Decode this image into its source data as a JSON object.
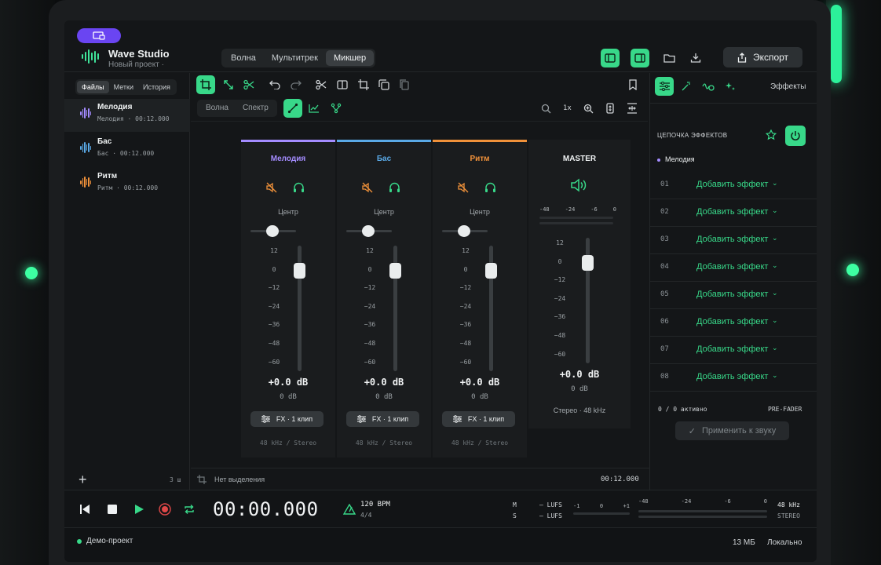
{
  "app": {
    "title": "Wave Studio",
    "subtitle": "Новый проект ·",
    "modes": [
      "Волна",
      "Мультитрек",
      "Микшер"
    ],
    "active_mode": "Микшер",
    "export_label": "Экспорт"
  },
  "sidebar": {
    "tabs": [
      "Файлы",
      "Метки",
      "История"
    ],
    "tracks": [
      {
        "name": "Мелодия",
        "meta": "Мелодия · 00:12.000",
        "color": "#a48cff"
      },
      {
        "name": "Бас",
        "meta": "Бас · 00:12.000",
        "color": "#5aa9e6"
      },
      {
        "name": "Ритм",
        "meta": "Ритм · 00:12.000",
        "color": "#f0913a"
      }
    ],
    "count": "3 ш"
  },
  "editor": {
    "views": [
      "Волна",
      "Спектр"
    ],
    "speed": "1x"
  },
  "mixer": {
    "scale": [
      "12",
      "0",
      "−12",
      "−24",
      "−36",
      "−48",
      "−60"
    ],
    "pan_label": "Центр",
    "channels": [
      {
        "name": "Мелодия",
        "color": "#a48cff",
        "gain": "+0.0 dB",
        "db": "0 dB",
        "fx": "FX · 1 клип",
        "format": "48 kHz / Stereo"
      },
      {
        "name": "Бас",
        "color": "#5aa9e6",
        "gain": "+0.0 dB",
        "db": "0 dB",
        "fx": "FX · 1 клип",
        "format": "48 kHz / Stereo"
      },
      {
        "name": "Ритм",
        "color": "#f0913a",
        "gain": "+0.0 dB",
        "db": "0 dB",
        "fx": "FX · 1 клип",
        "format": "48 kHz / Stereo"
      }
    ],
    "master": {
      "name": "MASTER",
      "meter_scale": [
        "-48",
        "-24",
        "-6",
        "0"
      ],
      "gain": "+0.0 dB",
      "db": "0 dB",
      "format": "Стерео · 48 kHz"
    }
  },
  "effects": {
    "tab_label": "Эффекты",
    "chain_title": "ЦЕПОЧКА ЭФФЕКТОВ",
    "track": "Мелодия",
    "slots": [
      {
        "num": "01",
        "label": "Добавить эффект"
      },
      {
        "num": "02",
        "label": "Добавить эффект"
      },
      {
        "num": "03",
        "label": "Добавить эффект"
      },
      {
        "num": "04",
        "label": "Добавить эффект"
      },
      {
        "num": "05",
        "label": "Добавить эффект"
      },
      {
        "num": "06",
        "label": "Добавить эффект"
      },
      {
        "num": "07",
        "label": "Добавить эффект"
      },
      {
        "num": "08",
        "label": "Добавить эффект"
      }
    ],
    "active_count": "0 / 0 активно",
    "pre_fader": "PRE-FADER",
    "apply_label": "Применить к звуку"
  },
  "status": {
    "selection": "Нет выделения",
    "duration": "00:12.000"
  },
  "transport": {
    "time": "00:00.000",
    "bpm": "120 BPM",
    "signature": "4/4",
    "lufs_m_label": "M",
    "lufs_s_label": "S",
    "lufs_m": "— LUFS",
    "lufs_s": "— LUFS",
    "lufs_scale": [
      "-1",
      "0",
      "+1"
    ],
    "rms_scale": [
      "-48",
      "-24",
      "-6",
      "0"
    ],
    "sample_rate": "48 kHz",
    "channels": "STEREO"
  },
  "footer": {
    "project": "Демо-проект",
    "size": "13 МБ",
    "storage": "Локально"
  },
  "colors": {
    "accent": "#38d889",
    "badge": "#6a45f2",
    "record": "#e04848"
  }
}
